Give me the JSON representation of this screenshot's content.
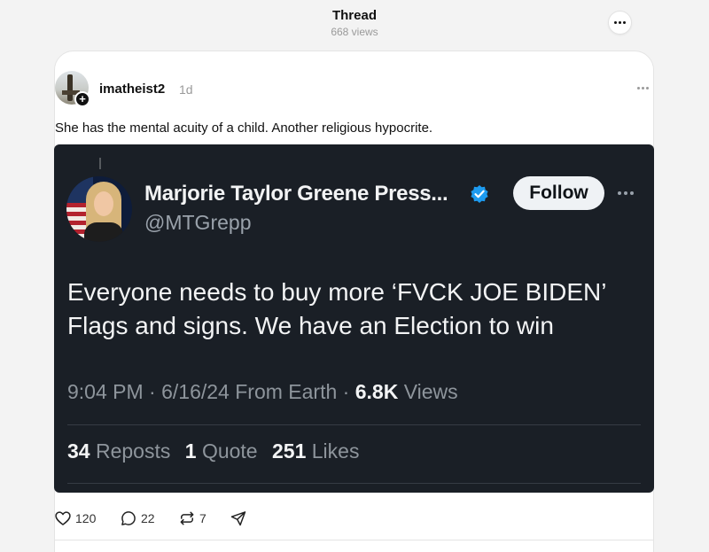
{
  "header": {
    "title": "Thread",
    "views": "668 views"
  },
  "post": {
    "username": "imatheist2",
    "time": "1d",
    "caption": "She has the mental acuity of a child. Another religious hypocrite.",
    "actions": {
      "likes": "120",
      "comments": "22",
      "reposts": "7"
    }
  },
  "embedded_tweet": {
    "name": "Marjorie Taylor Greene Press...",
    "handle": "@MTGrepp",
    "follow_label": "Follow",
    "text": "Everyone needs to buy more ‘FVCK JOE BIDEN’ Flags and signs. We have an Election to win",
    "meta": {
      "time": "9:04 PM",
      "date": "6/16/24",
      "source": "From Earth",
      "views_count": "6.8K",
      "views_label": "Views"
    },
    "stats": {
      "reposts_count": "34",
      "reposts_label": "Reposts",
      "quotes_count": "1",
      "quotes_label": "Quote",
      "likes_count": "251",
      "likes_label": "Likes"
    }
  },
  "colors": {
    "embed_background": "#1a1f26",
    "verified_badge": "#1d9bf0",
    "page_background": "#f3f3f3"
  },
  "icons": [
    "more-icon",
    "plus-icon",
    "verified-icon",
    "heart-icon",
    "comment-icon",
    "repost-icon",
    "share-icon"
  ]
}
